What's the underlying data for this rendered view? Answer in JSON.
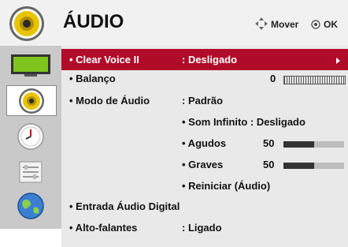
{
  "header": {
    "title": "ÁUDIO",
    "move_hint": "Mover",
    "ok_hint": "OK",
    "icons": [
      "speaker-icon",
      "move-arrows-icon",
      "ok-circle-icon"
    ]
  },
  "sidebar": {
    "items": [
      {
        "name": "picture",
        "icon": "tv-screen-icon"
      },
      {
        "name": "audio",
        "icon": "speaker-icon",
        "selected": true
      },
      {
        "name": "time",
        "icon": "clock-icon"
      },
      {
        "name": "option",
        "icon": "toolbox-icon"
      },
      {
        "name": "network",
        "icon": "globe-icon"
      }
    ]
  },
  "menu": {
    "clear_voice": {
      "label": "• Clear Voice II",
      "value": ": Desligado"
    },
    "balance": {
      "label": "• Balanço",
      "value": "0"
    },
    "audio_mode": {
      "label": "• Modo de Áudio",
      "value": ": Padrão"
    },
    "infinite_sound": {
      "label": "• Som Infinito : Desligado"
    },
    "treble": {
      "label": "• Agudos",
      "value": "50",
      "level": 0.5
    },
    "bass": {
      "label": "• Graves",
      "value": "50",
      "level": 0.5
    },
    "reset": {
      "label": "• Reiniciar (Áudio)"
    },
    "digital_out": {
      "label": "• Entrada Áudio Digital"
    },
    "speakers": {
      "label": "• Alto-falantes",
      "value": ": Ligado"
    }
  },
  "colors": {
    "highlight": "#b10b2a",
    "sidebar": "#c9c9c9",
    "panel": "#e9e9e9"
  }
}
